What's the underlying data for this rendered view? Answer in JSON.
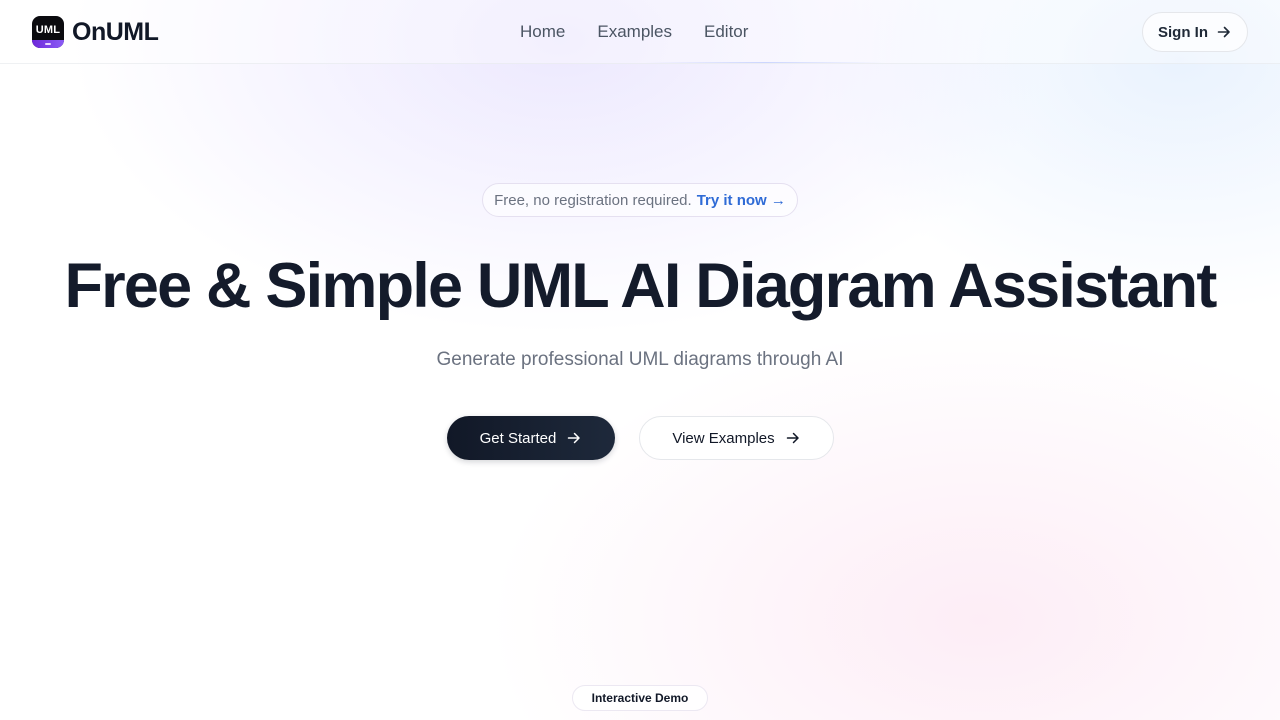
{
  "brand": {
    "logo_text": "UML",
    "name": "OnUML"
  },
  "nav": {
    "items": [
      {
        "label": "Home"
      },
      {
        "label": "Examples"
      },
      {
        "label": "Editor"
      }
    ]
  },
  "header": {
    "signin_label": "Sign In"
  },
  "hero": {
    "pill_text": "Free, no registration required.",
    "pill_link": "Try it now →",
    "title": "Free & Simple UML AI Diagram Assistant",
    "subtitle": "Generate professional UML diagrams through AI",
    "primary_button": "Get Started",
    "secondary_button": "View Examples",
    "demo_badge": "Interactive Demo"
  },
  "icons": {
    "arrow": "arrow-right-icon"
  },
  "colors": {
    "text_dark": "#141b2b",
    "muted": "#6b7280",
    "link": "#2f6bd6",
    "primary_button_bg": "#111827",
    "logo_accent": "#8b5cf6"
  }
}
